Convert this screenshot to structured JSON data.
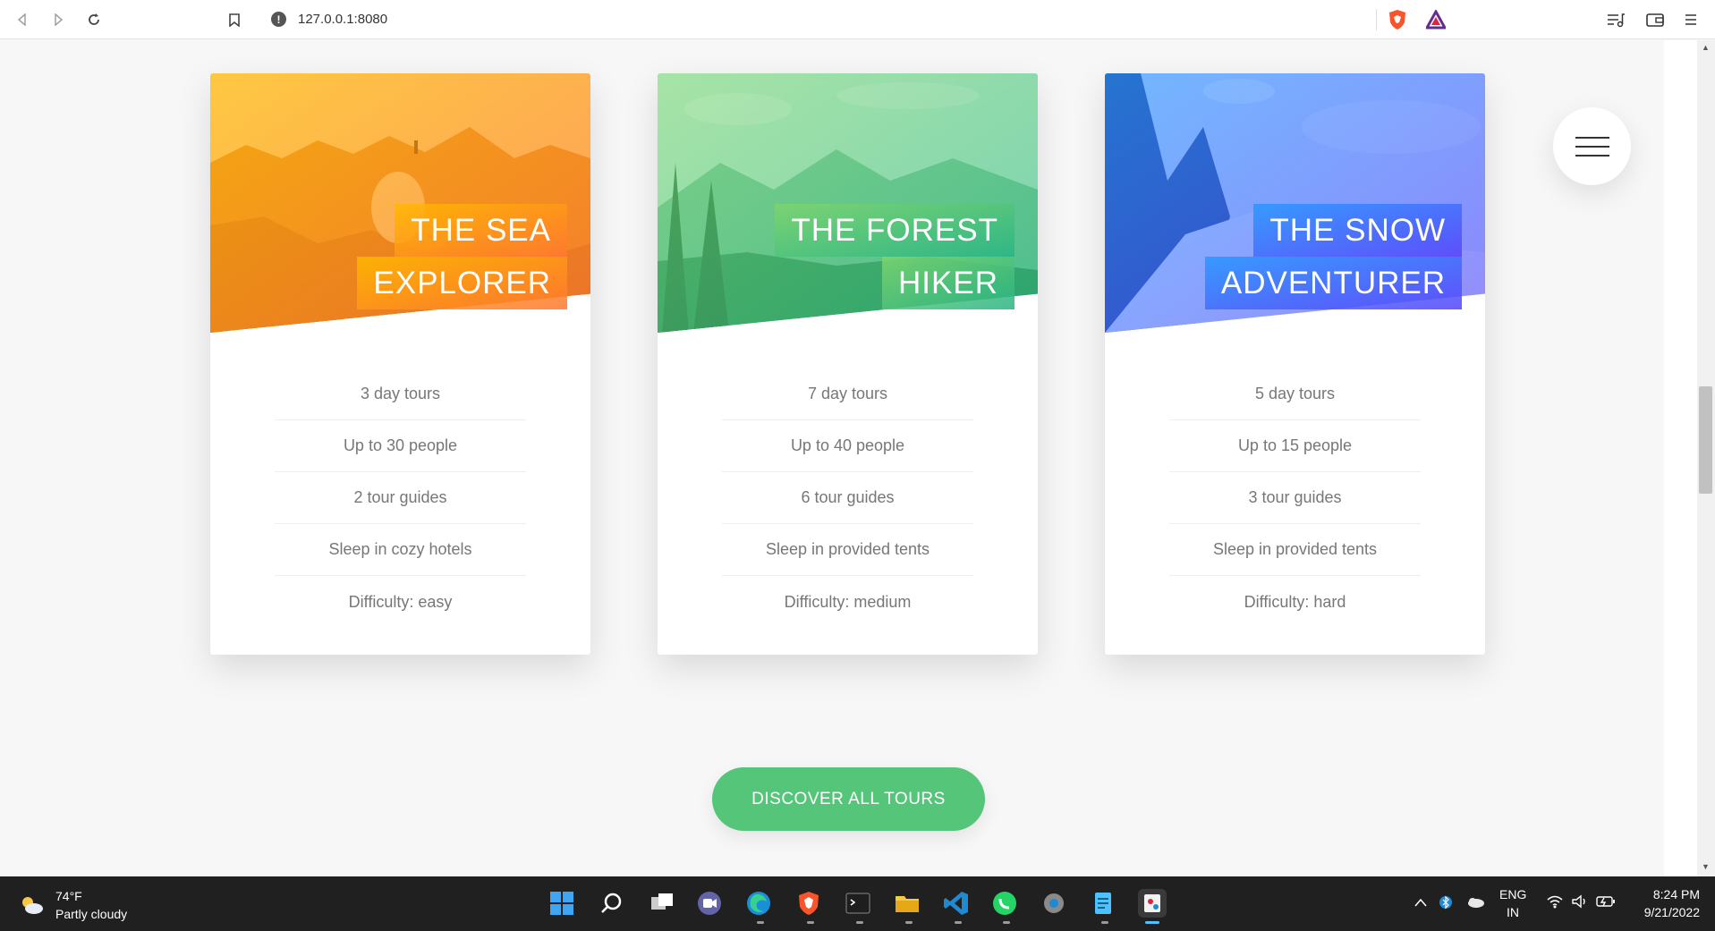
{
  "browser": {
    "url": "127.0.0.1:8080"
  },
  "cards": [
    {
      "heading_line1": "The Sea",
      "heading_line2": "Explorer",
      "color_from": "#ffb900",
      "color_to": "#ff7730",
      "details": [
        "3 day tours",
        "Up to 30 people",
        "2 tour guides",
        "Sleep in cozy hotels",
        "Difficulty: easy"
      ]
    },
    {
      "heading_line1": "The Forest",
      "heading_line2": "Hiker",
      "color_from": "#7ed56f",
      "color_to": "#28b485",
      "details": [
        "7 day tours",
        "Up to 40 people",
        "6 tour guides",
        "Sleep in provided tents",
        "Difficulty: medium"
      ]
    },
    {
      "heading_line1": "The Snow",
      "heading_line2": "Adventurer",
      "color_from": "#2998ff",
      "color_to": "#5643fa",
      "details": [
        "5 day tours",
        "Up to 15 people",
        "3 tour guides",
        "Sleep in provided tents",
        "Difficulty: hard"
      ]
    }
  ],
  "discover_button": "Discover all tours",
  "taskbar": {
    "temperature": "74°F",
    "weather": "Partly cloudy",
    "lang_line1": "ENG",
    "lang_line2": "IN",
    "time": "8:24 PM",
    "date": "9/21/2022"
  }
}
